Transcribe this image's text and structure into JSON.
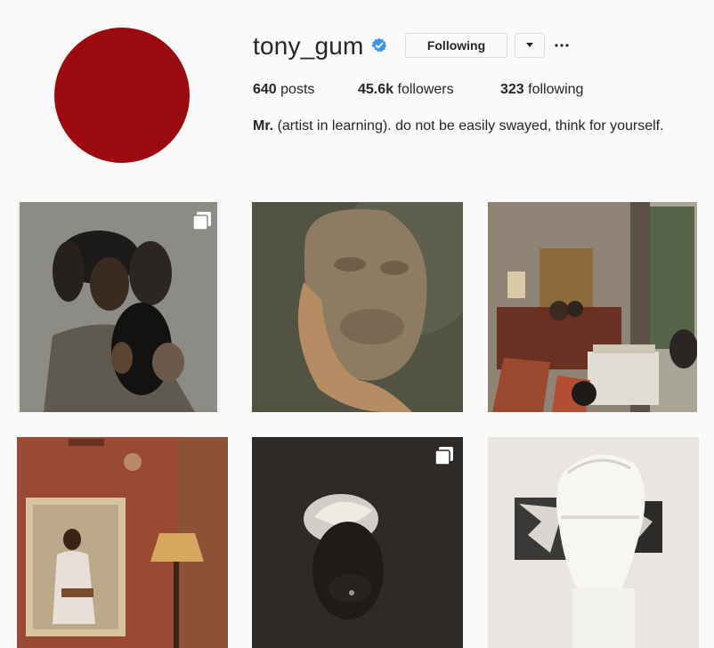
{
  "profile": {
    "username": "tony_gum",
    "verified": true,
    "avatar_color": "#9b0a10",
    "follow_label": "Following",
    "dropdown_icon": "caret-down-icon",
    "more_icon": "ellipsis-icon",
    "stats": {
      "posts_count": "640",
      "posts_label": "posts",
      "followers_count": "45.6k",
      "followers_label": "followers",
      "following_count": "323",
      "following_label": "following"
    },
    "bio_name": "Mr.",
    "bio_text": "(artist in learning). do not be easily swayed, think for yourself."
  },
  "posts": [
    {
      "subject": "portrait-woman-with-cat",
      "multi": true
    },
    {
      "subject": "hand-holding-mask",
      "multi": false
    },
    {
      "subject": "interior-room-with-chairs",
      "multi": false
    },
    {
      "subject": "framed-portrait-and-lamp",
      "multi": false
    },
    {
      "subject": "dark-portrait-headwrap",
      "multi": true
    },
    {
      "subject": "white-sculpture-head",
      "multi": false
    }
  ],
  "colors": {
    "verified_blue": "#3897f0",
    "border": "#dbdbdb",
    "text": "#262626",
    "background": "#fafafa"
  }
}
